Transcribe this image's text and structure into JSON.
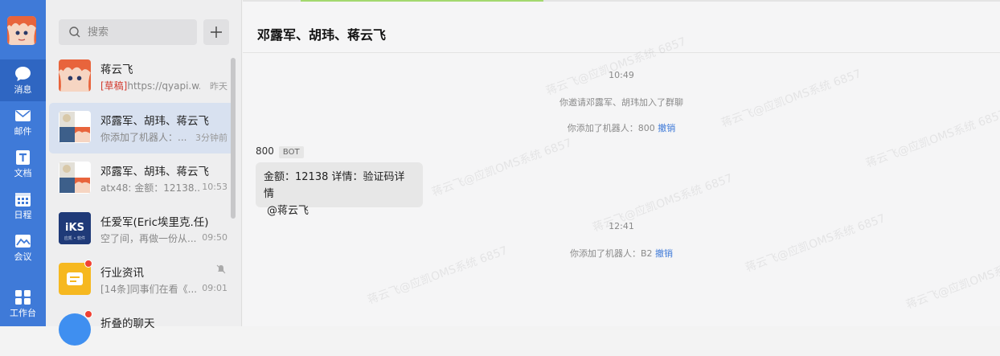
{
  "nav": {
    "items": [
      {
        "label": "消息",
        "icon": "chat-icon"
      },
      {
        "label": "邮件",
        "icon": "mail-icon"
      },
      {
        "label": "文档",
        "icon": "document-icon"
      },
      {
        "label": "日程",
        "icon": "calendar-icon"
      },
      {
        "label": "会议",
        "icon": "meeting-icon"
      },
      {
        "label": "工作台",
        "icon": "workbench-icon"
      }
    ]
  },
  "search": {
    "placeholder": "搜索"
  },
  "conversations": [
    {
      "name": "蒋云飞",
      "draft_tag": "[草稿]",
      "preview": "https://qyapi.w...",
      "time": "昨天"
    },
    {
      "name": "邓露军、胡玮、蒋云飞",
      "preview": "你添加了机器人：...",
      "time": "3分钟前"
    },
    {
      "name": "邓露军、胡玮、蒋云飞",
      "preview": "atx48: 金额：12138...",
      "time": "10:53"
    },
    {
      "name": "任爱军(Eric埃里克.任)",
      "preview": "空了间，再做一份从...",
      "time": "09:50",
      "avatar_text": "iKS",
      "avatar_sub": "应凯 • 软件"
    },
    {
      "name": "行业资讯",
      "preview": "[14条]同事们在看《...",
      "time": "09:01"
    },
    {
      "name": "折叠的聊天"
    }
  ],
  "chat": {
    "title": "邓露军、胡玮、蒋云飞",
    "messages": {
      "time1": "10:49",
      "sys1": "你邀请邓露军、胡玮加入了群聊",
      "sys2": "你添加了机器人：800",
      "undo1": "撤销",
      "sender": "800",
      "sender_badge": "BOT",
      "bubble_line1": "金额：12138  详情：验证码详情",
      "bubble_line2": "@蒋云飞",
      "time2": "12:41",
      "sys3": "你添加了机器人：B2",
      "undo2": "撤销"
    },
    "watermark": "蒋云飞@应凯OMS系统 6857"
  },
  "colors": {
    "nav_bg": "#3f7ad8",
    "nav_active": "#2f66c2",
    "badge": "#f04134",
    "link": "#3f7ad8"
  }
}
